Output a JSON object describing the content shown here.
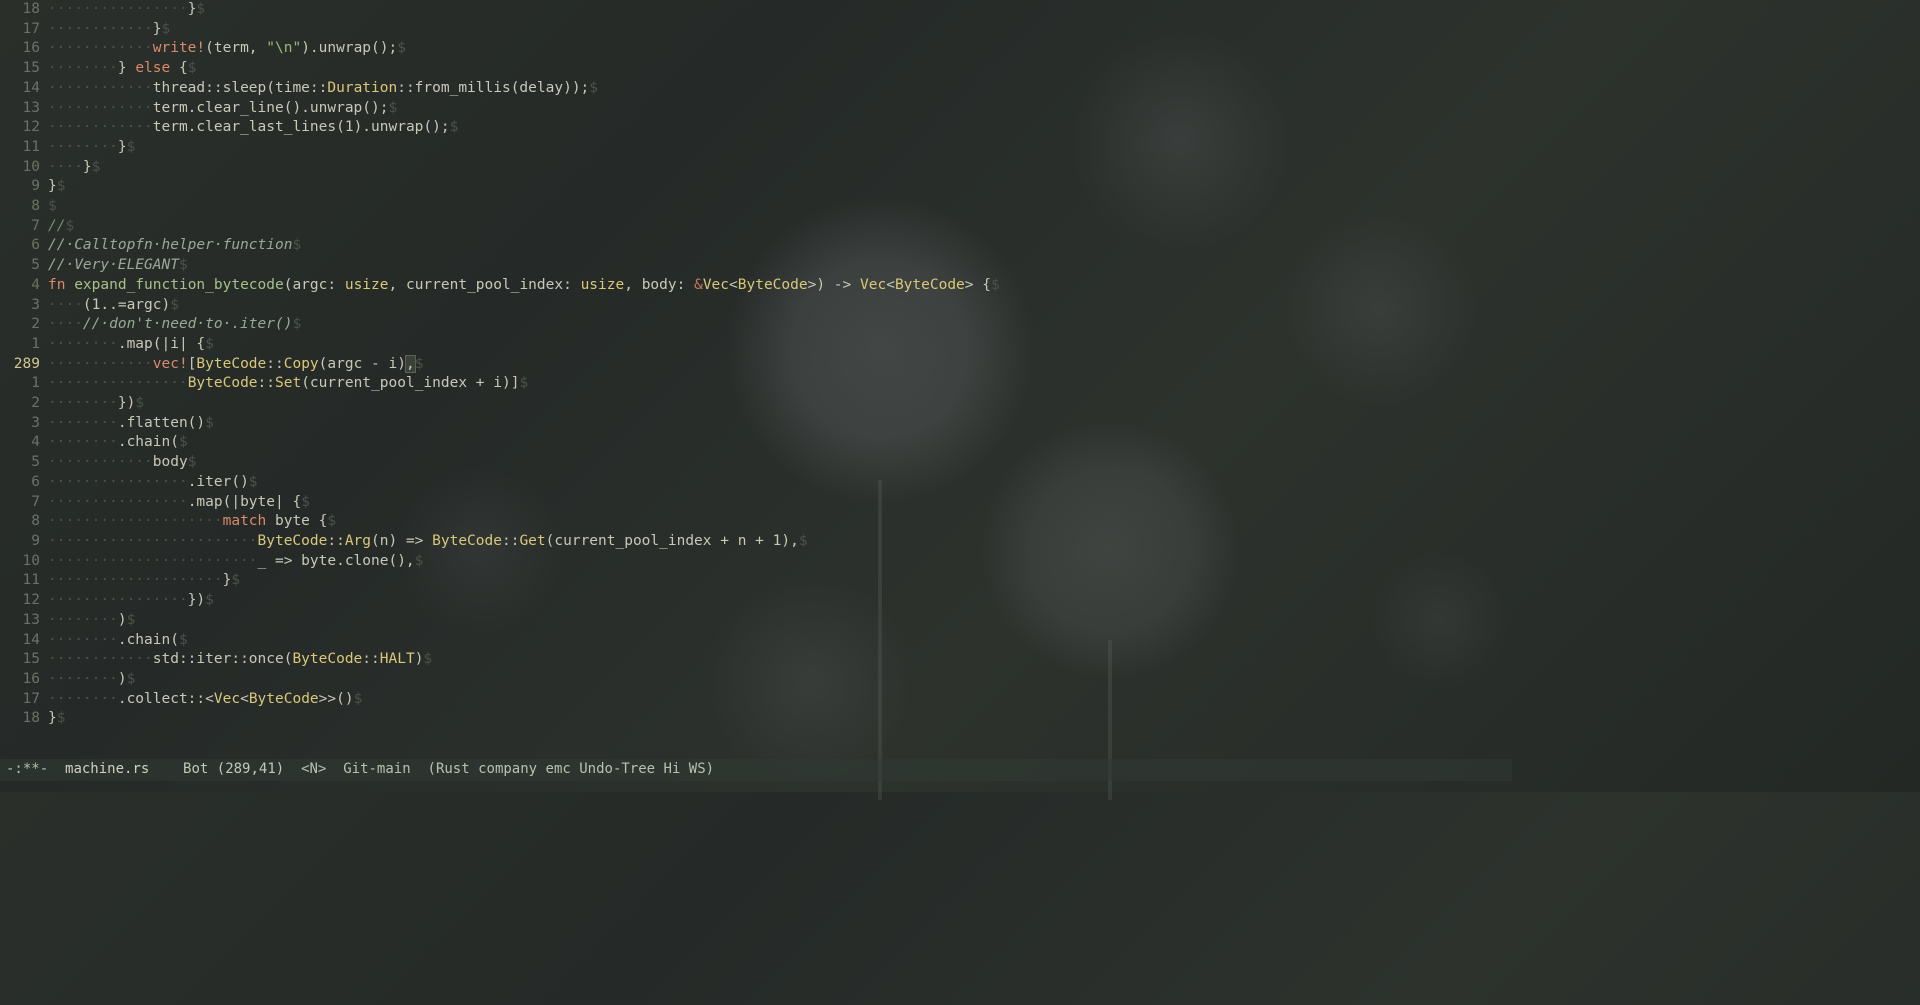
{
  "editor": {
    "current_line_number": "289",
    "lines": [
      {
        "n": "18",
        "ws": "················",
        "seg": [
          {
            "t": "}",
            "c": ""
          }
        ],
        "eol": "$"
      },
      {
        "n": "17",
        "ws": "············",
        "seg": [
          {
            "t": "}",
            "c": ""
          }
        ],
        "eol": "$"
      },
      {
        "n": "16",
        "ws": "············",
        "seg": [
          {
            "t": "write!",
            "c": "mac"
          },
          {
            "t": "(term, ",
            "c": ""
          },
          {
            "t": "\"\\n\"",
            "c": "str"
          },
          {
            "t": ").unwrap();",
            "c": ""
          }
        ],
        "eol": "$"
      },
      {
        "n": "15",
        "ws": "········",
        "seg": [
          {
            "t": "} ",
            "c": ""
          },
          {
            "t": "else",
            "c": "kw"
          },
          {
            "t": " {",
            "c": ""
          }
        ],
        "eol": "$"
      },
      {
        "n": "14",
        "ws": "············",
        "seg": [
          {
            "t": "thread::sleep(time::",
            "c": ""
          },
          {
            "t": "Duration",
            "c": "ty"
          },
          {
            "t": "::from_millis(delay));",
            "c": ""
          }
        ],
        "eol": "$"
      },
      {
        "n": "13",
        "ws": "············",
        "seg": [
          {
            "t": "term.clear_line().unwrap();",
            "c": ""
          }
        ],
        "eol": "$"
      },
      {
        "n": "12",
        "ws": "············",
        "seg": [
          {
            "t": "term.clear_last_lines(",
            "c": ""
          },
          {
            "t": "1",
            "c": "num"
          },
          {
            "t": ").unwrap();",
            "c": ""
          }
        ],
        "eol": "$"
      },
      {
        "n": "11",
        "ws": "········",
        "seg": [
          {
            "t": "}",
            "c": ""
          }
        ],
        "eol": "$"
      },
      {
        "n": "10",
        "ws": "····",
        "seg": [
          {
            "t": "}",
            "c": ""
          }
        ],
        "eol": "$"
      },
      {
        "n": "9",
        "ws": "",
        "seg": [
          {
            "t": "}",
            "c": ""
          }
        ],
        "eol": "$"
      },
      {
        "n": "8",
        "ws": "",
        "seg": [],
        "eol": "$"
      },
      {
        "n": "7",
        "ws": "",
        "seg": [
          {
            "t": "//",
            "c": "cm"
          }
        ],
        "eol": "$"
      },
      {
        "n": "6",
        "ws": "",
        "seg": [
          {
            "t": "//·Calltopfn·helper·function",
            "c": "cm2"
          }
        ],
        "eol": "$"
      },
      {
        "n": "5",
        "ws": "",
        "seg": [
          {
            "t": "//·Very·ELEGANT",
            "c": "cm2"
          }
        ],
        "eol": "$"
      },
      {
        "n": "4",
        "ws": "",
        "seg": [
          {
            "t": "fn ",
            "c": "kw"
          },
          {
            "t": "expand_function_bytecode",
            "c": "fn"
          },
          {
            "t": "(",
            "c": ""
          },
          {
            "t": "argc",
            "c": ""
          },
          {
            "t": ": ",
            "c": ""
          },
          {
            "t": "usize",
            "c": "ty"
          },
          {
            "t": ", ",
            "c": ""
          },
          {
            "t": "current_pool_index",
            "c": ""
          },
          {
            "t": ": ",
            "c": ""
          },
          {
            "t": "usize",
            "c": "ty"
          },
          {
            "t": ", ",
            "c": ""
          },
          {
            "t": "body",
            "c": ""
          },
          {
            "t": ": ",
            "c": ""
          },
          {
            "t": "&",
            "c": "kw2"
          },
          {
            "t": "Vec",
            "c": "ty"
          },
          {
            "t": "<",
            "c": ""
          },
          {
            "t": "ByteCode",
            "c": "ty"
          },
          {
            "t": ">) -> ",
            "c": ""
          },
          {
            "t": "Vec",
            "c": "ty"
          },
          {
            "t": "<",
            "c": ""
          },
          {
            "t": "ByteCode",
            "c": "ty"
          },
          {
            "t": "> {",
            "c": ""
          }
        ],
        "eol": "$"
      },
      {
        "n": "3",
        "ws": "····",
        "seg": [
          {
            "t": "(",
            "c": ""
          },
          {
            "t": "1",
            "c": "num"
          },
          {
            "t": "..=argc)",
            "c": ""
          }
        ],
        "eol": "$"
      },
      {
        "n": "2",
        "ws": "····",
        "seg": [
          {
            "t": "//·don't·need·to·.iter()",
            "c": "cm2"
          }
        ],
        "eol": "$"
      },
      {
        "n": "1",
        "ws": "········",
        "seg": [
          {
            "t": ".map(|",
            "c": ""
          },
          {
            "t": "i",
            "c": ""
          },
          {
            "t": "| {",
            "c": ""
          }
        ],
        "eol": "$"
      },
      {
        "n": "289",
        "current": true,
        "ws": "············",
        "seg": [
          {
            "t": "vec!",
            "c": "mac"
          },
          {
            "t": "[",
            "c": ""
          },
          {
            "t": "ByteCode",
            "c": "ty"
          },
          {
            "t": "::",
            "c": ""
          },
          {
            "t": "Copy",
            "c": "ty"
          },
          {
            "t": "(argc - i)",
            "c": ""
          },
          {
            "t": ",",
            "c": "",
            "cursor": true
          }
        ],
        "eol": "$"
      },
      {
        "n": "1",
        "ws": "················",
        "seg": [
          {
            "t": "ByteCode",
            "c": "ty"
          },
          {
            "t": "::",
            "c": ""
          },
          {
            "t": "Set",
            "c": "ty"
          },
          {
            "t": "(current_pool_index + i)]",
            "c": ""
          }
        ],
        "eol": "$"
      },
      {
        "n": "2",
        "ws": "········",
        "seg": [
          {
            "t": "})",
            "c": ""
          }
        ],
        "eol": "$"
      },
      {
        "n": "3",
        "ws": "········",
        "seg": [
          {
            "t": ".flatten()",
            "c": ""
          }
        ],
        "eol": "$"
      },
      {
        "n": "4",
        "ws": "········",
        "seg": [
          {
            "t": ".chain(",
            "c": ""
          }
        ],
        "eol": "$"
      },
      {
        "n": "5",
        "ws": "············",
        "seg": [
          {
            "t": "body",
            "c": ""
          }
        ],
        "eol": "$"
      },
      {
        "n": "6",
        "ws": "················",
        "seg": [
          {
            "t": ".iter()",
            "c": ""
          }
        ],
        "eol": "$"
      },
      {
        "n": "7",
        "ws": "················",
        "seg": [
          {
            "t": ".map(|",
            "c": ""
          },
          {
            "t": "byte",
            "c": ""
          },
          {
            "t": "| {",
            "c": ""
          }
        ],
        "eol": "$"
      },
      {
        "n": "8",
        "ws": "····················",
        "seg": [
          {
            "t": "match",
            "c": "kw"
          },
          {
            "t": " byte {",
            "c": ""
          }
        ],
        "eol": "$"
      },
      {
        "n": "9",
        "ws": "························",
        "seg": [
          {
            "t": "ByteCode",
            "c": "ty"
          },
          {
            "t": "::",
            "c": ""
          },
          {
            "t": "Arg",
            "c": "ty"
          },
          {
            "t": "(n) => ",
            "c": ""
          },
          {
            "t": "ByteCode",
            "c": "ty"
          },
          {
            "t": "::",
            "c": ""
          },
          {
            "t": "Get",
            "c": "ty"
          },
          {
            "t": "(current_pool_index + n + ",
            "c": ""
          },
          {
            "t": "1",
            "c": "num"
          },
          {
            "t": "),",
            "c": ""
          }
        ],
        "eol": "$"
      },
      {
        "n": "10",
        "ws": "························",
        "seg": [
          {
            "t": "_ => byte.clone(),",
            "c": ""
          }
        ],
        "eol": "$"
      },
      {
        "n": "11",
        "ws": "····················",
        "seg": [
          {
            "t": "}",
            "c": ""
          }
        ],
        "eol": "$"
      },
      {
        "n": "12",
        "ws": "················",
        "seg": [
          {
            "t": "})",
            "c": ""
          }
        ],
        "eol": "$"
      },
      {
        "n": "13",
        "ws": "········",
        "seg": [
          {
            "t": ")",
            "c": ""
          }
        ],
        "eol": "$"
      },
      {
        "n": "14",
        "ws": "········",
        "seg": [
          {
            "t": ".chain(",
            "c": ""
          }
        ],
        "eol": "$"
      },
      {
        "n": "15",
        "ws": "············",
        "seg": [
          {
            "t": "std::iter::once(",
            "c": ""
          },
          {
            "t": "ByteCode",
            "c": "ty"
          },
          {
            "t": "::",
            "c": ""
          },
          {
            "t": "HALT",
            "c": "ty"
          },
          {
            "t": ")",
            "c": ""
          }
        ],
        "eol": "$"
      },
      {
        "n": "16",
        "ws": "········",
        "seg": [
          {
            "t": ")",
            "c": ""
          }
        ],
        "eol": "$"
      },
      {
        "n": "17",
        "ws": "········",
        "seg": [
          {
            "t": ".collect::<",
            "c": ""
          },
          {
            "t": "Vec",
            "c": "ty"
          },
          {
            "t": "<",
            "c": ""
          },
          {
            "t": "ByteCode",
            "c": "ty"
          },
          {
            "t": ">>()",
            "c": ""
          }
        ],
        "eol": "$"
      },
      {
        "n": "18",
        "ws": "",
        "seg": [
          {
            "t": "}",
            "c": ""
          }
        ],
        "eol": "$"
      }
    ]
  },
  "modeline": {
    "modified": "-:**-",
    "filename": "machine.rs",
    "position_label": "Bot",
    "cursor_pos": "(289,41)",
    "state": "<N>",
    "vcs": "Git-main",
    "modes": "(Rust company emc Undo-Tree Hi WS)"
  }
}
